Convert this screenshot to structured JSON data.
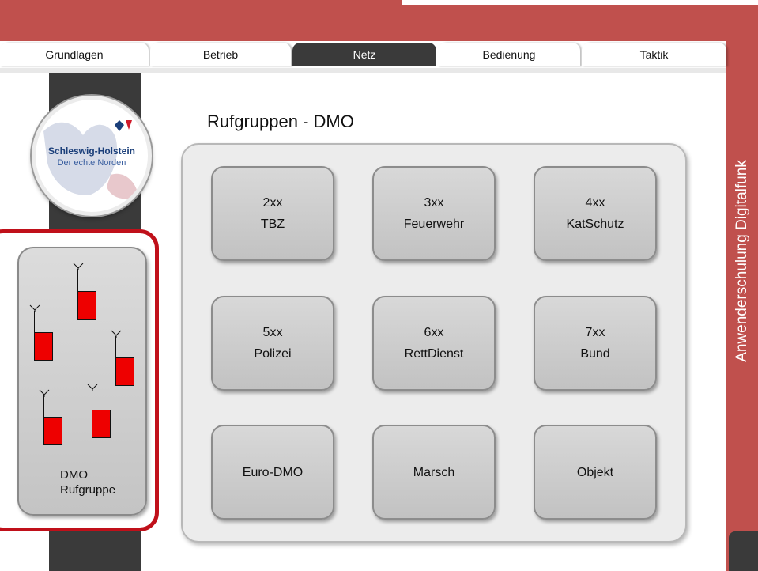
{
  "side_banner": "Anwenderschulung Digitalfunk",
  "tabs": [
    {
      "label": "Grundlagen",
      "active": false
    },
    {
      "label": "Betrieb",
      "active": false
    },
    {
      "label": "Netz",
      "active": true
    },
    {
      "label": "Bedienung",
      "active": false
    },
    {
      "label": "Taktik",
      "active": false
    }
  ],
  "logo": {
    "line1": "Schleswig-Holstein",
    "line2": "Der echte Norden"
  },
  "dmo_selector": {
    "line1": "DMO",
    "line2": "Rufgruppe"
  },
  "page_title": "Rufgruppen - DMO",
  "groups": [
    {
      "code": "2xx",
      "name": "TBZ"
    },
    {
      "code": "3xx",
      "name": "Feuerwehr"
    },
    {
      "code": "4xx",
      "name": "KatSchutz"
    },
    {
      "code": "5xx",
      "name": "Polizei"
    },
    {
      "code": "6xx",
      "name": "RettDienst"
    },
    {
      "code": "7xx",
      "name": "Bund"
    },
    {
      "code": "",
      "name": "Euro-DMO"
    },
    {
      "code": "",
      "name": "Marsch"
    },
    {
      "code": "",
      "name": "Objekt"
    }
  ],
  "colors": {
    "accent_red": "#c0504d",
    "selection_border": "#c0101a",
    "antenna_red": "#ee0000",
    "dark_strip": "#3a3a3a"
  }
}
